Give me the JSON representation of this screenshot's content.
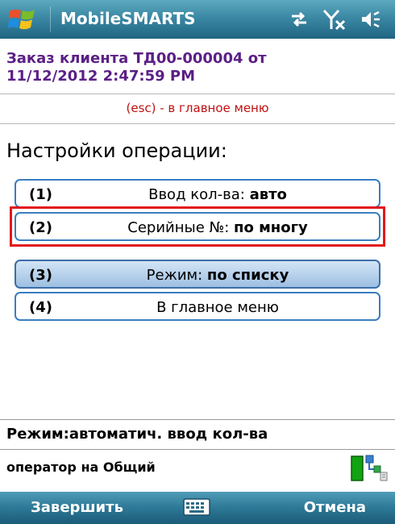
{
  "titlebar": {
    "app_title": "MobileSMARTS",
    "icons": [
      "windows-start-icon",
      "sync-arrows-icon",
      "signal-off-icon",
      "volume-icon"
    ]
  },
  "header": {
    "order_line1": "Заказ клиента ТД00-000004 от",
    "order_line2": "11/12/2012 2:47:59 PM",
    "esc_hint": "(esc) - в главное меню"
  },
  "main": {
    "section_title": "Настройки операции:",
    "items": [
      {
        "num": "(1)",
        "label": "Ввод кол-ва:",
        "value": "авто"
      },
      {
        "num": "(2)",
        "label": "Серийные №:",
        "value": "по многу"
      },
      {
        "num": "(3)",
        "label": "Режим:",
        "value": "по списку"
      },
      {
        "num": "(4)",
        "label": "В главное меню",
        "value": ""
      }
    ]
  },
  "status": {
    "mode": "Режим:автоматич. ввод кол-ва",
    "operator": "оператор на Общий"
  },
  "softkeys": {
    "left": "Завершить",
    "right": "Отмена"
  },
  "colors": {
    "titlebar": "#3b88a4",
    "order_title": "#5b1f86",
    "esc_hint": "#c01010",
    "button_border": "#3a7ec0",
    "focus_ring": "#e21818"
  }
}
